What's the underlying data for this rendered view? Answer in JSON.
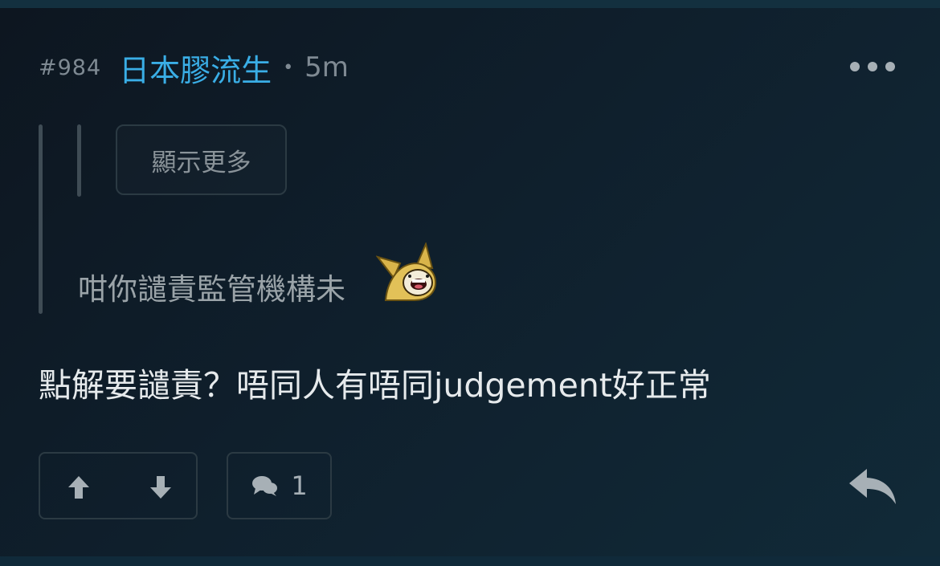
{
  "post": {
    "floor": "#984",
    "username": "日本膠流生",
    "separator": "•",
    "time": "5m",
    "more_icon": "more-horizontal-icon"
  },
  "quote": {
    "show_more_label": "顯示更多",
    "text": "咁你譴責監管機構未",
    "sticker": "sticker-image"
  },
  "reply": {
    "text": "點解要譴責？唔同人有唔同judgement好正常"
  },
  "actions": {
    "upvote_icon": "arrow-up-icon",
    "downvote_icon": "arrow-down-icon",
    "comment_icon": "comment-icon",
    "comment_count": "1",
    "reply_icon": "reply-icon"
  },
  "colors": {
    "username": "#3aaee6",
    "muted": "#7f8a93",
    "body_text": "#e6eaec",
    "background": "#0f1f2c"
  }
}
